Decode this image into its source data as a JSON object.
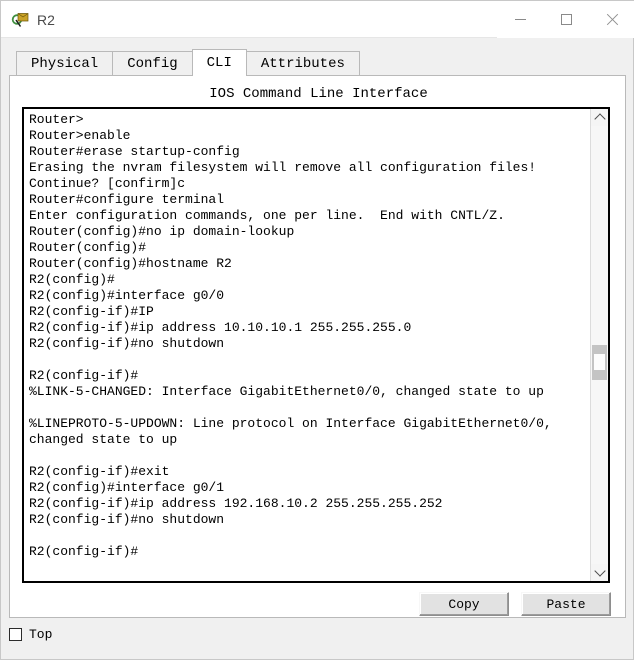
{
  "window": {
    "title": "R2",
    "icon": "router-device-icon",
    "controls": {
      "minimize": "minimize-icon",
      "maximize": "maximize-icon",
      "close": "close-icon"
    }
  },
  "tabs": [
    {
      "label": "Physical",
      "active": false
    },
    {
      "label": "Config",
      "active": false
    },
    {
      "label": "CLI",
      "active": true
    },
    {
      "label": "Attributes",
      "active": false
    }
  ],
  "panel": {
    "title": "IOS Command Line Interface"
  },
  "console": {
    "lines": [
      "Router>",
      "Router>enable",
      "Router#erase startup-config",
      "Erasing the nvram filesystem will remove all configuration files!",
      "Continue? [confirm]c",
      "Router#configure terminal",
      "Enter configuration commands, one per line.  End with CNTL/Z.",
      "Router(config)#no ip domain-lookup",
      "Router(config)#",
      "Router(config)#hostname R2",
      "R2(config)#",
      "R2(config)#interface g0/0",
      "R2(config-if)#IP",
      "R2(config-if)#ip address 10.10.10.1 255.255.255.0",
      "R2(config-if)#no shutdown",
      "",
      "R2(config-if)#",
      "%LINK-5-CHANGED: Interface GigabitEthernet0/0, changed state to up",
      "",
      "%LINEPROTO-5-UPDOWN: Line protocol on Interface GigabitEthernet0/0,",
      "changed state to up",
      "",
      "R2(config-if)#exit",
      "R2(config)#interface g0/1",
      "R2(config-if)#ip address 192.168.10.2 255.255.255.252",
      "R2(config-if)#no shutdown",
      "",
      "R2(config-if)#"
    ],
    "scrollbar": {
      "up_arrow": "chevron-up-icon",
      "down_arrow": "chevron-down-icon"
    }
  },
  "actions": {
    "copy_label": "Copy",
    "paste_label": "Paste"
  },
  "footer": {
    "top_checkbox_label": "Top",
    "top_checked": false
  },
  "colors": {
    "window_bg": "#f0f0f0",
    "panel_bg": "#ffffff",
    "console_border": "#000000",
    "button_face": "#e2e2e2",
    "scrollbar_thumb": "#c4c4c4"
  }
}
